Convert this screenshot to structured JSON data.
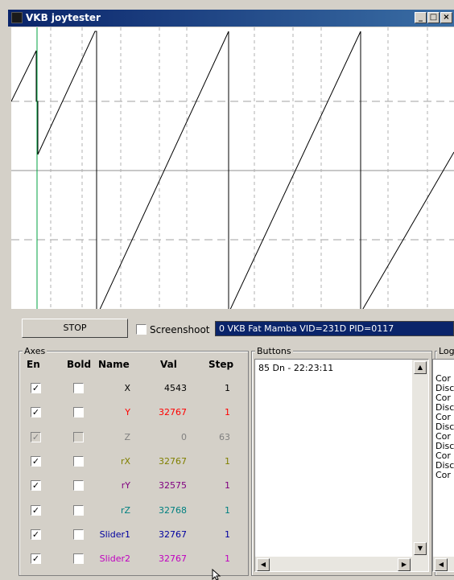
{
  "window": {
    "title": "VKB joytester",
    "min": "_",
    "max": "□",
    "close": "×"
  },
  "toolbar": {
    "stop_label": "STOP",
    "screenshot_label": "Screenshoot",
    "device": "0 VKB Fat Mamba  VID=231D PID=0117"
  },
  "axes": {
    "group_label": "Axes",
    "headers": {
      "en": "En",
      "bold": "Bold",
      "name": "Name",
      "val": "Val",
      "step": "Step"
    },
    "rows": [
      {
        "name": "X",
        "val": "4543",
        "step": "1",
        "color": "#000000",
        "en": true,
        "bold": false,
        "disabled": false
      },
      {
        "name": "Y",
        "val": "32767",
        "step": "1",
        "color": "#ff0000",
        "en": true,
        "bold": false,
        "disabled": false
      },
      {
        "name": "Z",
        "val": "0",
        "step": "63",
        "color": "#808080",
        "en": true,
        "bold": false,
        "disabled": true
      },
      {
        "name": "rX",
        "val": "32767",
        "step": "1",
        "color": "#808000",
        "en": true,
        "bold": false,
        "disabled": false
      },
      {
        "name": "rY",
        "val": "32575",
        "step": "1",
        "color": "#800080",
        "en": true,
        "bold": false,
        "disabled": false
      },
      {
        "name": "rZ",
        "val": "32768",
        "step": "1",
        "color": "#008080",
        "en": true,
        "bold": false,
        "disabled": false
      },
      {
        "name": "Slider1",
        "val": "32767",
        "step": "1",
        "color": "#0000a0",
        "en": true,
        "bold": false,
        "disabled": false
      },
      {
        "name": "Slider2",
        "val": "32767",
        "step": "1",
        "color": "#c000c0",
        "en": true,
        "bold": false,
        "disabled": false
      }
    ]
  },
  "buttons_panel": {
    "group_label": "Buttons",
    "items": [
      "85 Dn - 22:23:11"
    ]
  },
  "log_panel": {
    "group_label": "Log",
    "lines": [
      "",
      "Cor",
      "Disc",
      "Cor",
      "Disc",
      "Cor",
      "Disc",
      "Cor",
      "Disc",
      "Cor",
      "Disc",
      "Cor"
    ]
  },
  "colors": {
    "title_bar": "#0a246a",
    "trace_cursor": "#00a040",
    "device_highlight": "#0a246a"
  }
}
